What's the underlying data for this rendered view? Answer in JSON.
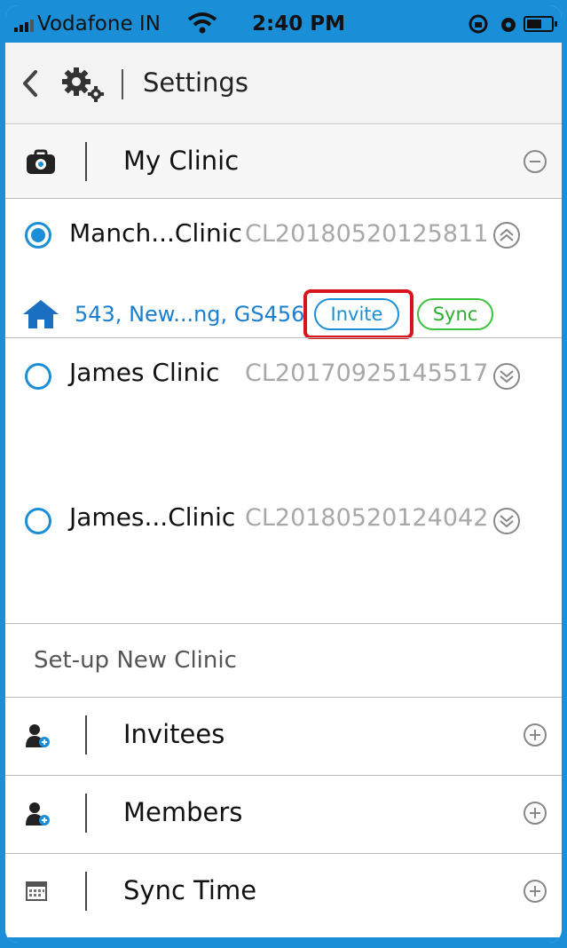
{
  "status_bar": {
    "carrier": "Vodafone IN",
    "time": "2:40 PM"
  },
  "header": {
    "title": "Settings"
  },
  "my_clinic": {
    "label": "My Clinic",
    "clinics": [
      {
        "name": "Manch...Clinic",
        "code": "CL20180520125811",
        "selected": true,
        "address": "543, New...ng, GS456",
        "invite_label": "Invite",
        "sync_label": "Sync"
      },
      {
        "name": "James Clinic",
        "code": "CL20170925145517",
        "selected": false
      },
      {
        "name": "James...Clinic",
        "code": "CL20180520124042",
        "selected": false
      }
    ]
  },
  "setup_new_clinic": {
    "label": "Set-up New Clinic"
  },
  "sections": [
    {
      "label": "Invitees",
      "icon": "user-add-icon"
    },
    {
      "label": "Members",
      "icon": "user-add-icon"
    },
    {
      "label": "Sync Time",
      "icon": "calendar-icon"
    }
  ],
  "colors": {
    "accent": "#1a8fd8",
    "sync_green": "#3cc13c",
    "highlight_red": "#d9141c"
  }
}
